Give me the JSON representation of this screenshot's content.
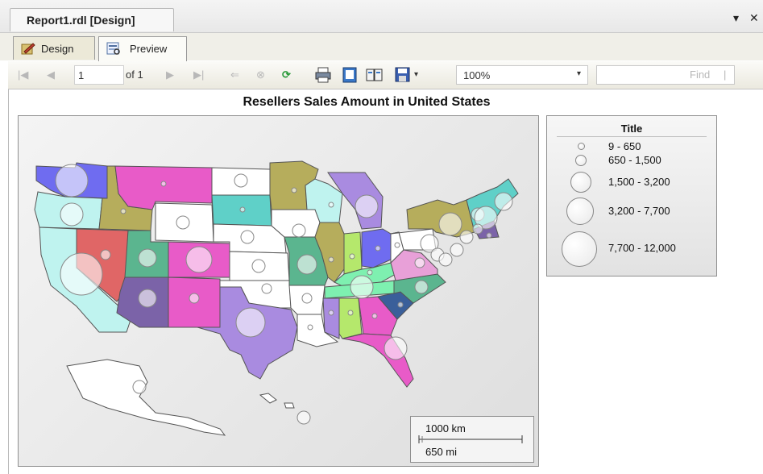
{
  "window": {
    "doc_tab_title": "Report1.rdl [Design]",
    "pin_glyph": "▾",
    "close_glyph": "✕"
  },
  "mode_tabs": [
    {
      "label": "Design",
      "icon": "design-icon"
    },
    {
      "label": "Preview",
      "icon": "preview-icon",
      "active": true
    }
  ],
  "toolbar": {
    "first_page": "|◀",
    "prev_page": "◀",
    "page_number": "1",
    "of_label": "of 1",
    "next_page": "▶",
    "last_page": "▶|",
    "back": "⇐",
    "stop": "⊗",
    "refresh": "⟳",
    "zoom_value": "100%",
    "zoom_arrow": "▾",
    "find_label": "Find",
    "find_sep": "|",
    "export_arrow": "▾"
  },
  "report": {
    "title": "Resellers Sales Amount in United States"
  },
  "legend": {
    "title": "Title",
    "items": [
      {
        "label": "9 - 650"
      },
      {
        "label": "650 - 1,500"
      },
      {
        "label": "1,500 - 3,200"
      },
      {
        "label": "3,200 - 7,700"
      },
      {
        "label": "7,700 - 12,000"
      }
    ]
  },
  "scale": {
    "km": "1000 km",
    "mi": "650 mi"
  },
  "colors": {
    "pink": "#e85bc8",
    "blue": "#6f6cf0",
    "teal": "#5fd0c8",
    "purple": "#a98be0",
    "olive": "#b6ad5c",
    "green": "#5bb58f",
    "red": "#e06666",
    "violet": "#7b63a8",
    "lime": "#b5e86c",
    "light_cyan": "#bff3ef",
    "white": "#ffffff"
  }
}
